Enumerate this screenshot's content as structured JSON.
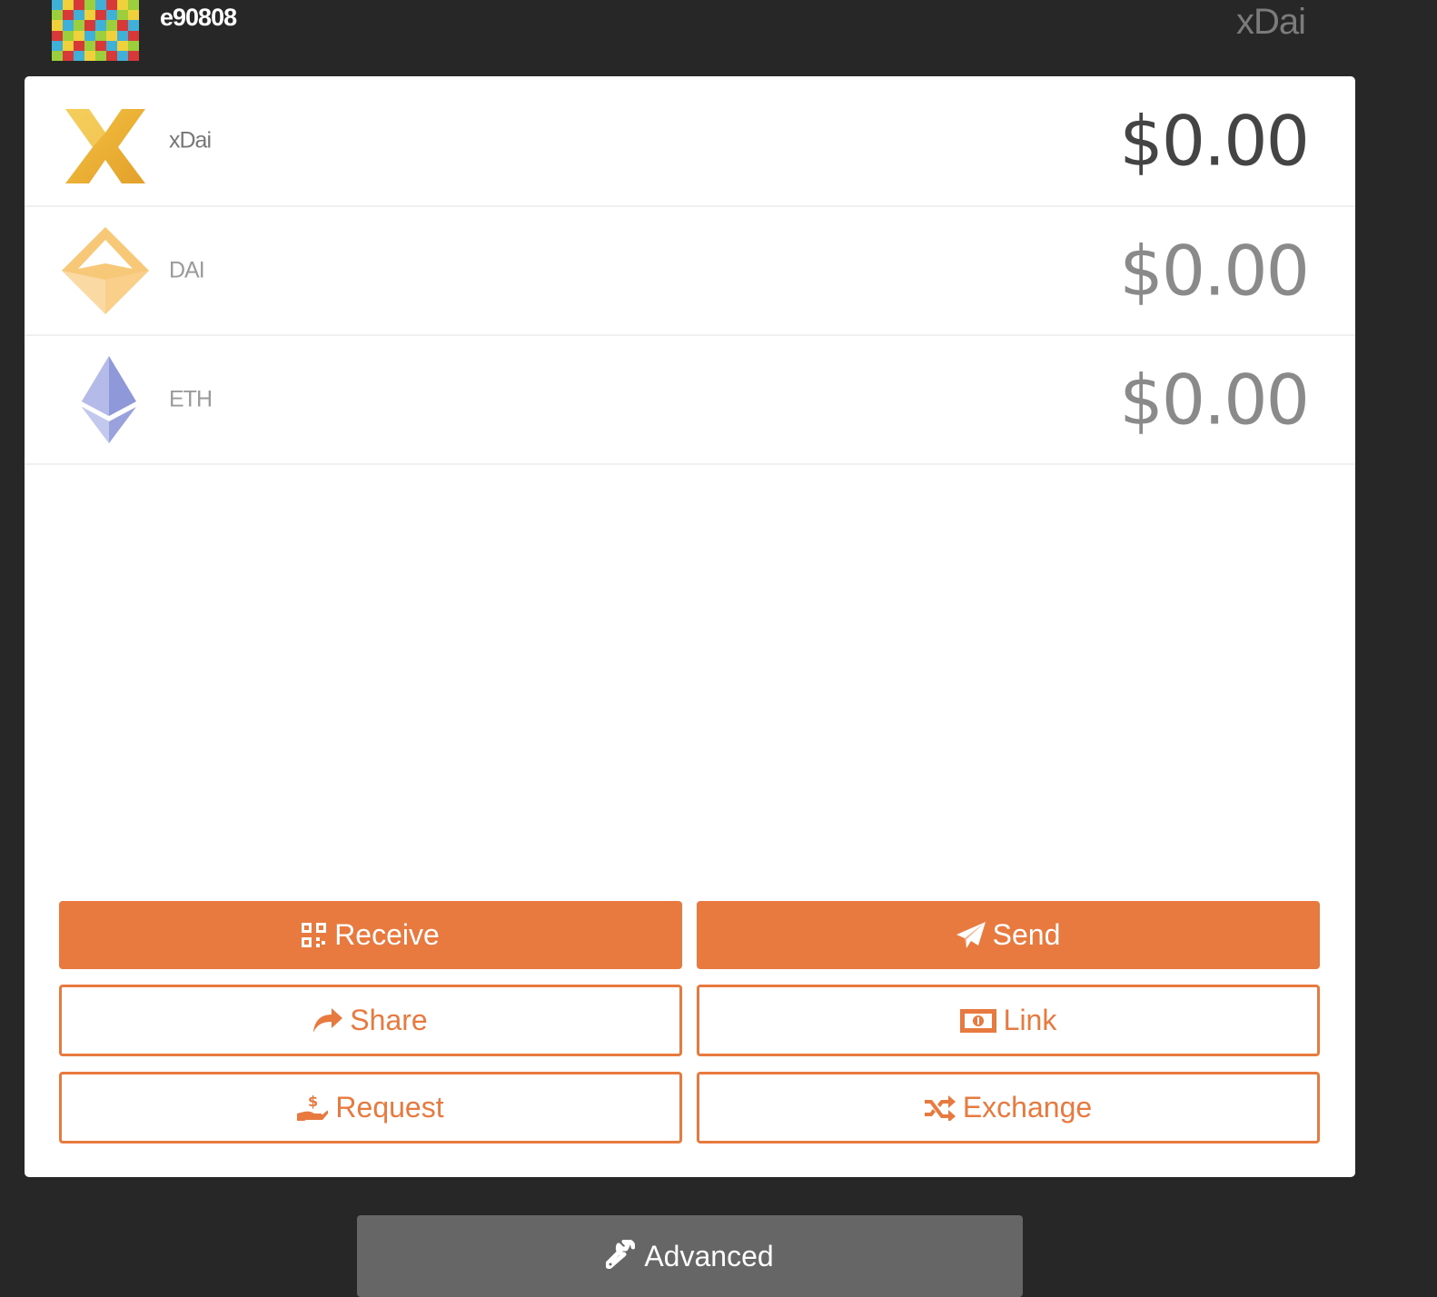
{
  "header": {
    "address": "e90808",
    "network": "xDai"
  },
  "tokens": [
    {
      "name": "xDai",
      "amount": "$0.00",
      "icon": "xdai-icon"
    },
    {
      "name": "DAI",
      "amount": "$0.00",
      "icon": "dai-icon"
    },
    {
      "name": "ETH",
      "amount": "$0.00",
      "icon": "eth-icon"
    }
  ],
  "actions": {
    "receive": "Receive",
    "send": "Send",
    "share": "Share",
    "link": "Link",
    "request": "Request",
    "exchange": "Exchange"
  },
  "advanced": {
    "label": "Advanced"
  },
  "colors": {
    "accent": "#e8793f",
    "background": "#272727",
    "card": "#ffffff",
    "advanced": "#666666"
  },
  "blockie_colors": [
    "#3fb0d8",
    "#f0d13c",
    "#d83838",
    "#9bd03c",
    "#3fb0d8",
    "#d83838",
    "#f0d13c",
    "#9bd03c",
    "#9bd03c",
    "#d83838",
    "#3fb0d8",
    "#f0d13c",
    "#d83838",
    "#3fb0d8",
    "#9bd03c",
    "#f0d13c",
    "#f0d13c",
    "#3fb0d8",
    "#9bd03c",
    "#d83838",
    "#3fb0d8",
    "#9bd03c",
    "#d83838",
    "#3fb0d8",
    "#d83838",
    "#9bd03c",
    "#f0d13c",
    "#3fb0d8",
    "#9bd03c",
    "#f0d13c",
    "#3fb0d8",
    "#d83838",
    "#3fb0d8",
    "#f0d13c",
    "#d83838",
    "#9bd03c",
    "#d83838",
    "#3fb0d8",
    "#f0d13c",
    "#9bd03c",
    "#9bd03c",
    "#d83838",
    "#3fb0d8",
    "#f0d13c",
    "#9bd03c",
    "#d83838",
    "#3fb0d8",
    "#d83838"
  ]
}
